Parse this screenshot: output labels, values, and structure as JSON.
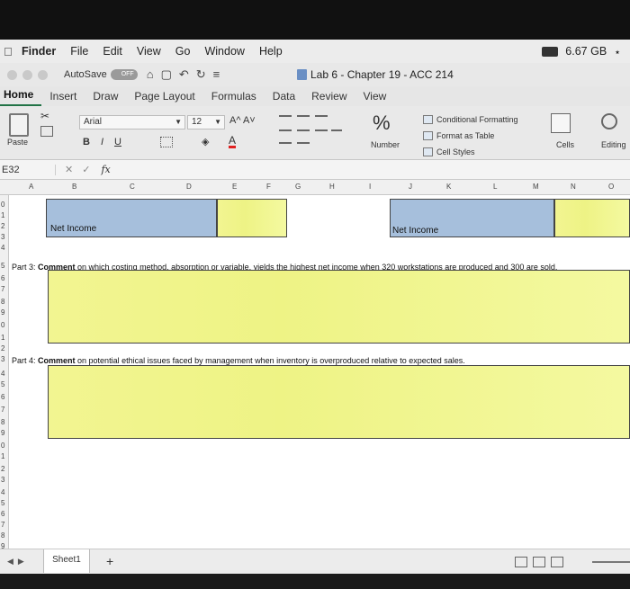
{
  "menubar": {
    "app": "Finder",
    "items": [
      "File",
      "Edit",
      "View",
      "Go",
      "Window",
      "Help"
    ],
    "memory": "6.67 GB"
  },
  "titlebar": {
    "autosave_label": "AutoSave",
    "autosave_state": "OFF",
    "document_title": "Lab 6 - Chapter 19 - ACC 214"
  },
  "tabs": [
    "Home",
    "Insert",
    "Draw",
    "Page Layout",
    "Formulas",
    "Data",
    "Review",
    "View"
  ],
  "ribbon": {
    "paste_label": "Paste",
    "font_name": "Arial",
    "font_size": "12",
    "grow_shrink": "A^ A˅",
    "bold": "B",
    "italic": "I",
    "underline": "U",
    "number_symbol": "%",
    "number_label": "Number",
    "conditional_formatting": "Conditional Formatting",
    "format_as_table": "Format as Table",
    "cell_styles": "Cell Styles",
    "cells_label": "Cells",
    "editing_label": "Editing"
  },
  "formula_bar": {
    "name_box": "E32",
    "fx": "fx"
  },
  "columns": [
    "A",
    "B",
    "C",
    "D",
    "E",
    "F",
    "G",
    "H",
    "I",
    "J",
    "K",
    "L",
    "M",
    "N",
    "O"
  ],
  "rows": [
    "0",
    "1",
    "2",
    "3",
    "4",
    "5",
    "6",
    "7",
    "8",
    "9",
    "0",
    "1",
    "2",
    "3",
    "4",
    "5",
    "6",
    "7",
    "8",
    "9",
    "0",
    "1",
    "2",
    "3",
    "4",
    "5",
    "6",
    "7",
    "8",
    "9"
  ],
  "sheet": {
    "net_income_left": "Net Income",
    "net_income_right": "Net Income",
    "part3_prefix": "Part 3: ",
    "part3_bold": "Comment",
    "part3_rest": " on which costing method, absorption or variable, yields the highest net income when 320 workstations are produced and 300 are sold.",
    "part4_prefix": "Part 4: ",
    "part4_bold": "Comment",
    "part4_rest": " on potential ethical issues faced by management when inventory is overproduced relative to expected sales."
  },
  "bottom": {
    "sheet_tab": "Sheet1",
    "add": "+"
  },
  "colors": {
    "input_yellow": "#f2f591",
    "label_blue": "#a6bfdc",
    "excel_green": "#217346"
  }
}
